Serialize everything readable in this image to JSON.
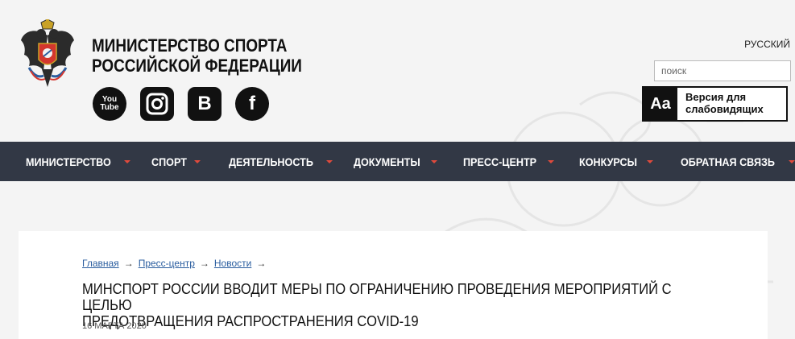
{
  "header": {
    "title_line1": "МИНИСТЕРСТВО СПОРТА",
    "title_line2": "РОССИЙСКОЙ ФЕДЕРАЦИИ",
    "language": "РУССКИЙ",
    "search_placeholder": "поиск",
    "vision_icon_text": "Aa",
    "vision_label_line1": "Версия для",
    "vision_label_line2": "слабовидящих",
    "socials": {
      "youtube_line1": "You",
      "youtube_line2": "Tube",
      "vk": "B",
      "facebook": "f"
    }
  },
  "nav": {
    "items": [
      {
        "label": "МИНИСТЕРСТВО"
      },
      {
        "label": "СПОРТ"
      },
      {
        "label": "ДЕЯТЕЛЬНОСТЬ"
      },
      {
        "label": "ДОКУМЕНТЫ"
      },
      {
        "label": "ПРЕСС-ЦЕНТР"
      },
      {
        "label": "КОНКУРСЫ"
      },
      {
        "label": "ОБРАТНАЯ СВЯЗЬ"
      }
    ]
  },
  "breadcrumb": {
    "items": [
      "Главная",
      "Пресс-центр",
      "Новости"
    ]
  },
  "article": {
    "title_line1": "МИНСПОРТ РОССИИ ВВОДИТ МЕРЫ ПО ОГРАНИЧЕНИЮ ПРОВЕДЕНИЯ МЕРОПРИЯТИЙ С ЦЕЛЬЮ",
    "title_line2": "ПРЕДОТВРАЩЕНИЯ РАСПРОСТРАНЕНИЯ COVID-19",
    "date": "16 МАРТА 2020"
  },
  "colors": {
    "nav_bg": "#323845",
    "accent_caret": "#e04a3c",
    "link": "#2a5d9f"
  }
}
